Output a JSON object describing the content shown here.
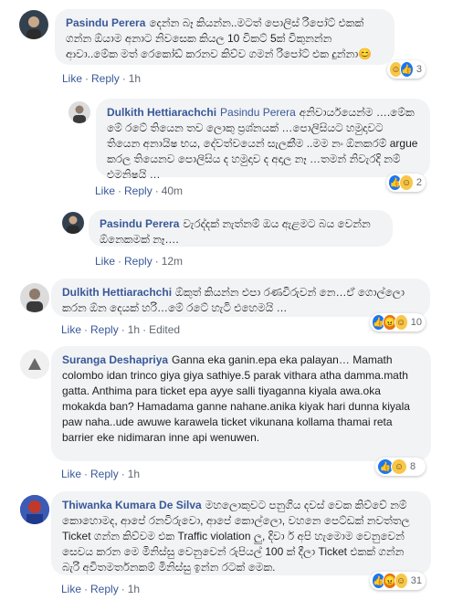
{
  "comments": [
    {
      "author": "Pasindu Perera",
      "text": "දෙන්න බෑ කියන්න..මටත් පොලිස් රිපෝට් එකක් ගන්න ඕයාම අනාට නිවසෙක කියල 10 විකට් 5ක් විකුනන්න ආවා..මේක මත් රෙකෝඩ් කරනව කිව්ව ගමන් රිපෝට් එක දුන්නා😊",
      "like": "Like",
      "reply": "Reply",
      "time": "1h",
      "reaction_icons": [
        "haha-icon",
        "like-icon"
      ],
      "reaction_count": "3"
    },
    {
      "author": "Dulkith Hettiarachchi",
      "mention": "Pasindu Perera",
      "text": "අනිවාර්යයෙන්ම ….මේක මේ රටේ තියෙන තව ලොකු ප්‍රශ්නයක් …පොලිසියට හමුදාවට තියෙන අනායිෂ භය, දේවත්වයෙන් සැලකීම ..මම නං ඕනකරම් argue කරල තියෙනව පොලිසිය ද හමුදාව ද අදාල නෑ …තමන් නිවැරදි නම් එමනිෂයි …",
      "like": "Like",
      "reply": "Reply",
      "time": "40m",
      "reaction_icons": [
        "like-icon",
        "haha-icon"
      ],
      "reaction_count": "2"
    },
    {
      "author": "Pasindu Perera",
      "text": "වැරද්දක් නැත්නම් ඔය ඇළමට බය වෙන්න ඕනෙකමක් නෑ….",
      "like": "Like",
      "reply": "Reply",
      "time": "12m"
    },
    {
      "author": "Dulkith Hettiarachchi",
      "text": "ඕකුත් කියන්න එපා රණවිරුවන් නෙ…ඒ ගොල්ලො කරන ඕන දෙයක් හරි…මේ රටේ හැටි එහෙමයි …",
      "like": "Like",
      "reply": "Reply",
      "time": "1h",
      "edited": "Edited",
      "reaction_icons": [
        "like-icon",
        "angry-icon",
        "haha-icon"
      ],
      "reaction_count": "10"
    },
    {
      "author": "Suranga Deshapriya",
      "text": "Ganna eka ganin.epa eka palayan… Mamath colombo idan trinco giya giya sathiye.5 parak vithara atha damma.math gatta. Anthima para ticket epa ayye salli tiyaganna kiyala awa.oka mokakda ban? Hamadama ganne nahane.anika kiyak hari dunna kiyala paw naha..ude awuwe karawela ticket vikunana kollama thamai reta barrier eke nidimaran inne api wenuwen.",
      "like": "Like",
      "reply": "Reply",
      "time": "1h",
      "reaction_icons": [
        "like-icon",
        "haha-icon"
      ],
      "reaction_count": "8"
    },
    {
      "author": "Thiwanka Kumara De Silva",
      "text": "මහලොකුවට පනුගිය දවස් වෙක කිව්වේ නම් කොහොමද, ආපේ රනවිරුවො, ආපේ කොල්ලො, වහනෙ පෙට්ඩක් නවත්තල Ticket ගන්න කිව්වම එක Traffic violation ලු, දිවා ර් අපි හැමොම වෙනුවෙන් සෙවය කරන මෙ මිනිස්සු වෙනුවෙන් රුපියල් 100 ක් දීලා Ticket එකක් ගන්න බැරි අවිතමර්තනකම් මිනිස්සු ඉන්න රටක් මෙක.",
      "like": "Like",
      "reply": "Reply",
      "time": "1h",
      "reaction_icons": [
        "like-icon",
        "angry-icon",
        "haha-icon"
      ],
      "reaction_count": "31"
    }
  ]
}
